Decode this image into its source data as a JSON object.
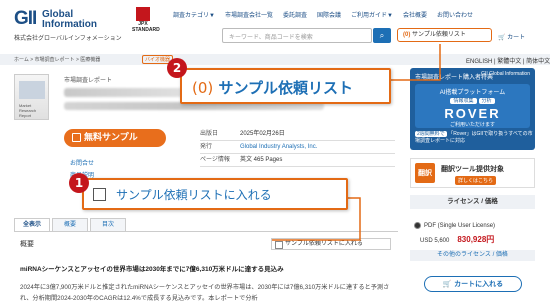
{
  "header": {
    "logo_mark": "GII",
    "logo_name_1": "Global",
    "logo_name_2": "Information",
    "logo_sub": "株式会社グローバルインフォメーション",
    "jpx_1": "JPX",
    "jpx_2": "STANDARD",
    "nav": [
      "調査カテゴリ▼",
      "市場調査会社一覧",
      "委託調査",
      "国際会議",
      "ご利用ガイド▼",
      "会社概要",
      "お問い合わせ"
    ],
    "search_placeholder": "キーワード、商品コードを検索",
    "sample_list_count": "(0)",
    "sample_list_label": "サンプル依頼リスト",
    "cart": "カート"
  },
  "breadcrumb": "ホーム > 市場調査レポート > 医療機器",
  "breadcrumb_tag": "バイオ機器",
  "languages": "ENGLISH | 繁體中文 | 简体中文",
  "product": {
    "category": "市場調査レポート",
    "code_suffix": "61925",
    "free_sample_button": "無料サンプル",
    "meta": [
      {
        "k": "出版日",
        "v": "2025年02月26日"
      },
      {
        "k": "発行",
        "v": "Global Industry Analysts, Inc."
      },
      {
        "k": "ページ情報",
        "v": "英文 465 Pages"
      }
    ],
    "qa_1": "お問合せ",
    "qa_2": "商品説明"
  },
  "tabs": [
    "全表示",
    "概要",
    "目次"
  ],
  "section_title": "概要",
  "add_to_list_small": "サンプル依頼リストに入れる",
  "lead_text": "miRNAシーケンスとアッセイの世界市場は2030年までに7億6,310万米ドルに達する見込み",
  "body_text": "2024年に3億7,900万米ドルと推定されたmiRNAシーケンスとアッセイの世界市場は、2030年には7億6,310万米ドルに達すると予測され、分析期間2024-2030年のCAGRは12.4%で成長する見込みです。本レポートで分析",
  "rover": {
    "header": "市場調査レポート購入者特典",
    "logo": "GII Global Information",
    "platform": "AI搭載プラットフォーム",
    "pill_1": "情報収集",
    "pill_2": "分析",
    "name": "ROVER",
    "use": "ご利用いただけます",
    "foot_tag": "2週間無料で",
    "foot_text": "「Rover」はGIIで取り扱うすべての市場調査レポートに対応"
  },
  "translate": {
    "badge": "翻訳",
    "title": "翻訳ツール提供対象",
    "link": "詳しくはこちら"
  },
  "license": {
    "title": "ライセンス / 価格",
    "option": "PDF (Single User License)",
    "usd": "USD 5,600",
    "jpy": "830,928円",
    "other": "その他のライセンス / 価格",
    "cart_button": "カートに入れる"
  },
  "callout_2": {
    "number": "2",
    "count": "(0)",
    "label": "サンプル依頼リスト"
  },
  "callout_1": {
    "number": "1",
    "label": "サンプル依頼リストに入れる"
  }
}
